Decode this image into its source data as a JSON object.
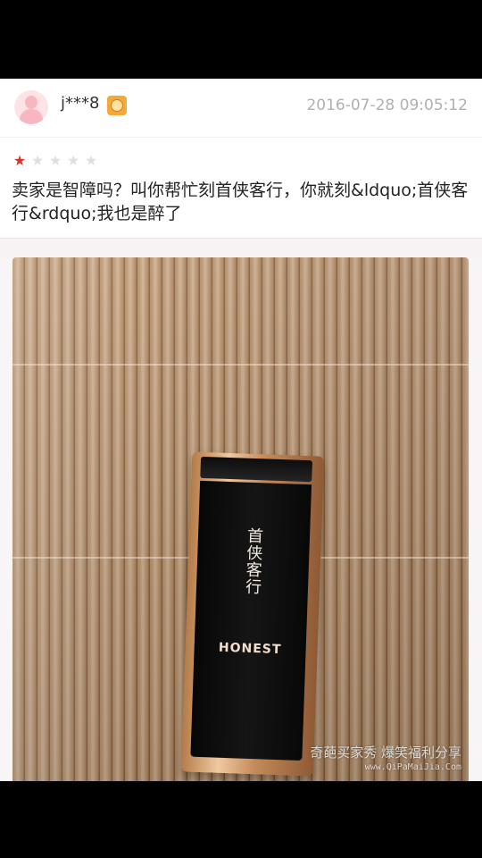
{
  "review": {
    "username": "j***8",
    "timestamp": "2016-07-28 09:05:12",
    "rating": 1,
    "max_rating": 5,
    "text": "卖家是智障吗？叫你帮忙刻首侠客行，你就刻&ldquo;首侠客行&rdquo;我也是醉了"
  },
  "photo": {
    "engraving": "首侠客行",
    "brand": "HONEST"
  },
  "watermark": {
    "line1": "奇葩买家秀 爆笑福利分享",
    "line2": "www.QiPaMaiJia.Com"
  },
  "icons": {
    "avatar": "default-user-avatar-icon",
    "member_badge": "member-badge-icon",
    "star_filled": "star-filled-icon",
    "star_empty": "star-empty-icon"
  },
  "colors": {
    "star_filled": "#d6342b",
    "star_empty": "#dfdfdf",
    "avatar": "#f7b6c0",
    "badge": "#f3a93b",
    "timestamp": "#b0b0b0"
  }
}
